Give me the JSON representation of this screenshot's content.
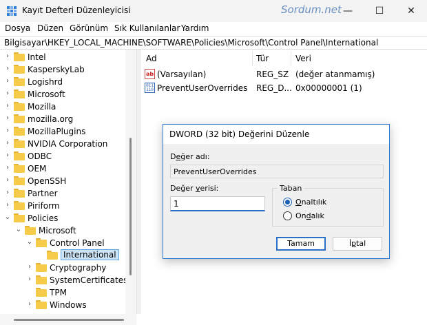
{
  "window": {
    "title": "Kayıt Defteri Düzenleyicisi",
    "watermark": "Sordum.net",
    "minimize_glyph": "—",
    "maximize_glyph": "☐",
    "close_glyph": "✕"
  },
  "menu": [
    {
      "label": "Dosya"
    },
    {
      "label": "Düzen"
    },
    {
      "label": "Görünüm"
    },
    {
      "label": "Sık Kullanılanlar"
    },
    {
      "label": "Yardım"
    }
  ],
  "address": "Bilgisayar\\HKEY_LOCAL_MACHINE\\SOFTWARE\\Policies\\Microsoft\\Control Panel\\International",
  "tree": [
    {
      "label": "Intel",
      "expanded": false
    },
    {
      "label": "KasperskyLab",
      "expanded": false
    },
    {
      "label": "Logishrd",
      "expanded": false
    },
    {
      "label": "Microsoft",
      "expanded": false
    },
    {
      "label": "Mozilla",
      "expanded": false
    },
    {
      "label": "mozilla.org",
      "expanded": false
    },
    {
      "label": "MozillaPlugins",
      "expanded": false
    },
    {
      "label": "NVIDIA Corporation",
      "expanded": false
    },
    {
      "label": "ODBC",
      "expanded": false
    },
    {
      "label": "OEM",
      "expanded": false
    },
    {
      "label": "OpenSSH",
      "expanded": false
    },
    {
      "label": "Partner",
      "expanded": false
    },
    {
      "label": "Piriform",
      "expanded": false
    },
    {
      "label": "Policies",
      "expanded": true
    },
    {
      "label": "Microsoft",
      "expanded": true
    },
    {
      "label": "Control Panel",
      "expanded": true
    },
    {
      "label": "International",
      "selected": true
    },
    {
      "label": "Cryptography",
      "expanded": false
    },
    {
      "label": "SystemCertificates",
      "expanded": false
    },
    {
      "label": "TPM"
    },
    {
      "label": "Windows",
      "expanded": false
    }
  ],
  "list": {
    "columns": [
      "Ad",
      "Tür",
      "Veri"
    ],
    "rows": [
      {
        "name": "(Varsayılan)",
        "type": "REG_SZ",
        "data": "(değer atanmamış)",
        "icon": "string-value-icon"
      },
      {
        "name": "PreventUserOverrides",
        "type": "REG_D...",
        "data": "0x00000001 (1)",
        "icon": "binary-value-icon"
      }
    ]
  },
  "dialog": {
    "title": "DWORD (32 bit) Değerini Düzenle",
    "name_label_prefix": "D",
    "name_label_underlined": "e",
    "name_label_rest": "ğer adı:",
    "value_name": "PreventUserOverrides",
    "data_label_prefix": "Değer ",
    "data_label_underlined": "v",
    "data_label_rest": "erisi:",
    "value_data": "1",
    "base_label": "Taban",
    "hex_underlined": "O",
    "hex_rest": "naltılık",
    "dec_prefix": "On",
    "dec_underlined": "d",
    "dec_rest": "alık",
    "ok_label": "Tamam",
    "cancel_prefix": "İ",
    "cancel_underlined": "p",
    "cancel_rest": "tal",
    "selected_base": "hex"
  },
  "colors": {
    "accent": "#2a6fc7",
    "folder": "#f6cb4a",
    "selection": "#cce4f7"
  }
}
